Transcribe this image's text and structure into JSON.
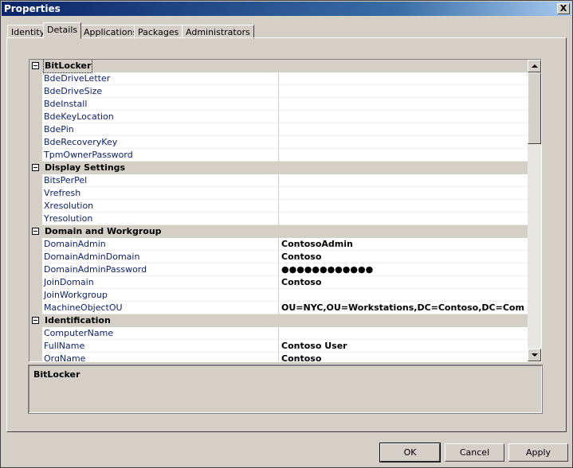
{
  "window": {
    "title": "Properties",
    "close_label": "X"
  },
  "tabs": [
    {
      "label": "Identity"
    },
    {
      "label": "Details"
    },
    {
      "label": "Applications"
    },
    {
      "label": "Packages"
    },
    {
      "label": "Administrators"
    }
  ],
  "categories": [
    {
      "label": "BitLocker",
      "rows": [
        {
          "name": "BdeDriveLetter",
          "value": ""
        },
        {
          "name": "BdeDriveSize",
          "value": ""
        },
        {
          "name": "BdeInstall",
          "value": ""
        },
        {
          "name": "BdeKeyLocation",
          "value": ""
        },
        {
          "name": "BdePin",
          "value": ""
        },
        {
          "name": "BdeRecoveryKey",
          "value": ""
        },
        {
          "name": "TpmOwnerPassword",
          "value": ""
        }
      ]
    },
    {
      "label": "Display Settings",
      "rows": [
        {
          "name": "BitsPerPel",
          "value": ""
        },
        {
          "name": "Vrefresh",
          "value": ""
        },
        {
          "name": "Xresolution",
          "value": ""
        },
        {
          "name": "Yresolution",
          "value": ""
        }
      ]
    },
    {
      "label": "Domain and Workgroup",
      "rows": [
        {
          "name": "DomainAdmin",
          "value": "ContosoAdmin"
        },
        {
          "name": "DomainAdminDomain",
          "value": "Contoso"
        },
        {
          "name": "DomainAdminPassword",
          "value": "●●●●●●●●●●●●"
        },
        {
          "name": "JoinDomain",
          "value": "Contoso"
        },
        {
          "name": "JoinWorkgroup",
          "value": ""
        },
        {
          "name": "MachineObjectOU",
          "value": "OU=NYC,OU=Workstations,DC=Contoso,DC=Com"
        }
      ]
    },
    {
      "label": "Identification",
      "rows": [
        {
          "name": "ComputerName",
          "value": ""
        },
        {
          "name": "FullName",
          "value": "Contoso User"
        },
        {
          "name": "OrgName",
          "value": "Contoso"
        }
      ]
    }
  ],
  "help": {
    "title": "BitLocker"
  },
  "buttons": {
    "ok": "OK",
    "cancel": "Cancel",
    "apply": "Apply"
  }
}
